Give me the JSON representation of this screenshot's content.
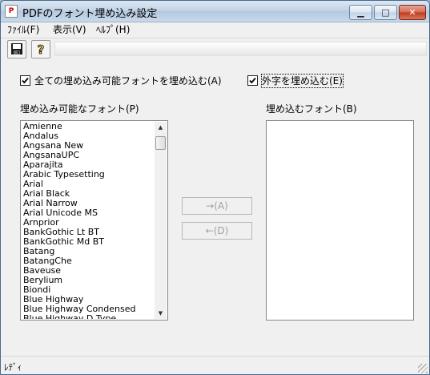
{
  "window": {
    "title": "PDFのフォント埋め込み設定",
    "app_icon_text": "PDF",
    "minimize_glyph": "▁",
    "maximize_glyph": "□",
    "close_glyph": "✕"
  },
  "menu": {
    "file": "ﾌｧｲﾙ(F)",
    "view": "表示(V)",
    "help": "ﾍﾙﾌﾟ(H)"
  },
  "toolbar": {
    "save_icon": "floppy-disk-icon",
    "help_icon": "question-mark-icon"
  },
  "options": {
    "embed_all": {
      "label": "全ての埋め込み可能フォントを埋め込む(A)",
      "checked": true
    },
    "embed_external": {
      "label": "外字を埋め込む(E)",
      "checked": true
    }
  },
  "embeddable": {
    "label": "埋め込み可能なフォント(P)",
    "fonts": [
      "Amienne",
      "Andalus",
      "Angsana New",
      "AngsanaUPC",
      "Aparajita",
      "Arabic Typesetting",
      "Arial",
      "Arial Black",
      "Arial Narrow",
      "Arial Unicode MS",
      "Arnprior",
      "BankGothic Lt BT",
      "BankGothic Md BT",
      "Batang",
      "BatangChe",
      "Baveuse",
      "Berylium",
      "Biondi",
      "Blue Highway",
      "Blue Highway Condensed",
      "Blue Highway D Type"
    ]
  },
  "embedded": {
    "label": "埋め込むフォント(B)",
    "fonts": []
  },
  "buttons": {
    "add": "→(A)",
    "remove": "←(D)"
  },
  "status": {
    "text": "ﾚﾃﾞｨ"
  }
}
